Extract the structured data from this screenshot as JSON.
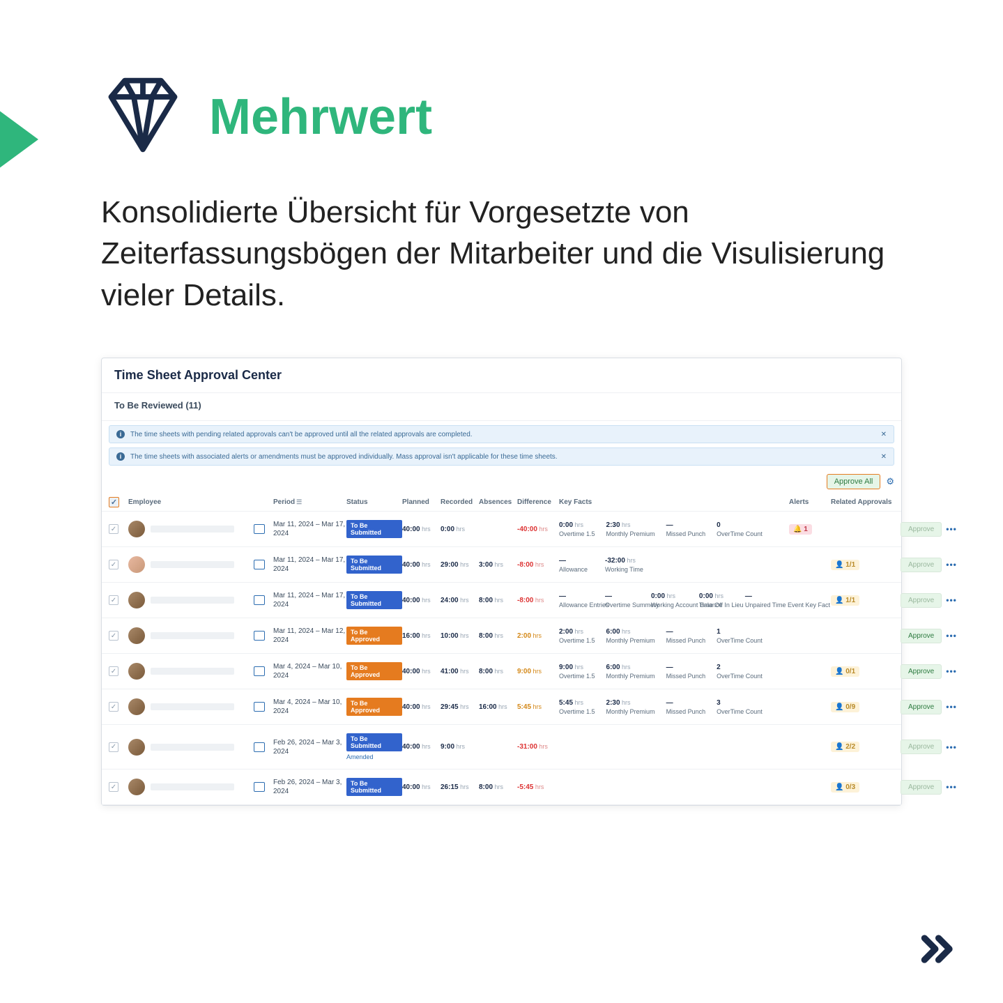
{
  "header": {
    "title": "Mehrwert",
    "subtitle": "Konsolidierte Übersicht für Vorgesetzte von Zeiterfassungsbögen der Mitarbeiter und die Visulisierung vieler Details."
  },
  "app": {
    "title": "Time Sheet Approval Center",
    "section": "To Be Reviewed (11)",
    "info1": "The time sheets with pending related approvals can't be approved until all the related approvals are completed.",
    "info2": "The time sheets with associated alerts or amendments must be approved individually. Mass approval isn't applicable for these time sheets.",
    "close_label": "✕",
    "approve_all": "Approve All",
    "approve_btn": "Approve",
    "hrs_suffix": " hrs",
    "dots": "•••",
    "columns": {
      "employee": "Employee",
      "period": "Period",
      "status": "Status",
      "planned": "Planned",
      "recorded": "Recorded",
      "absences": "Absences",
      "difference": "Difference",
      "keyfacts": "Key Facts",
      "alerts": "Alerts",
      "related": "Related Approvals"
    },
    "status_labels": {
      "to_be_submitted": "To Be Submitted",
      "to_be_approved": "To Be Approved",
      "amended": "Amended"
    },
    "rows": [
      {
        "period": "Mar 11, 2024 – Mar 17, 2024",
        "status": "to_be_submitted",
        "planned": "40:00",
        "recorded": "0:00",
        "absences": "",
        "difference": "-40:00",
        "diff_class": "neg",
        "keyfacts": [
          {
            "top": "0:00",
            "top_unit": " hrs",
            "bot": "Overtime 1.5"
          },
          {
            "top": "2:30",
            "top_unit": " hrs",
            "bot": "Monthly Premium"
          },
          {
            "top": "—",
            "bot": "Missed Punch"
          },
          {
            "top": "0",
            "bot": "OverTime Count"
          }
        ],
        "alert": "1",
        "ra": "",
        "approve_active": false,
        "avatar": "c"
      },
      {
        "period": "Mar 11, 2024 – Mar 17, 2024",
        "status": "to_be_submitted",
        "planned": "40:00",
        "recorded": "29:00",
        "absences": "3:00",
        "difference": "-8:00",
        "diff_class": "neg",
        "keyfacts": [
          {
            "top": "—",
            "bot": "Allowance"
          },
          {
            "top": "-32:00",
            "top_unit": " hrs",
            "bot": "Working Time"
          }
        ],
        "alert": "",
        "ra": "1/1",
        "approve_active": false,
        "avatar": "b"
      },
      {
        "period": "Mar 11, 2024 – Mar 17, 2024",
        "status": "to_be_submitted",
        "planned": "40:00",
        "recorded": "24:00",
        "absences": "8:00",
        "difference": "-8:00",
        "diff_class": "neg",
        "keyfacts": [
          {
            "top": "—",
            "bot": "Allowance Entries"
          },
          {
            "top": "—",
            "bot": "Overtime Summery"
          },
          {
            "top": "0:00",
            "top_unit": " hrs",
            "bot": "Working Account Balance"
          },
          {
            "top": "0:00",
            "top_unit": " hrs",
            "bot": "Time Off In Lieu"
          },
          {
            "top": "—",
            "bot": "Unpaired Time Event Key Fact"
          }
        ],
        "alert": "",
        "ra": "1/1",
        "approve_active": false,
        "avatar": "c"
      },
      {
        "period": "Mar 11, 2024 – Mar 12, 2024",
        "status": "to_be_approved",
        "planned": "16:00",
        "recorded": "10:00",
        "absences": "8:00",
        "difference": "2:00",
        "diff_class": "pos",
        "keyfacts": [
          {
            "top": "2:00",
            "top_unit": " hrs",
            "bot": "Overtime 1.5"
          },
          {
            "top": "6:00",
            "top_unit": " hrs",
            "bot": "Monthly Premium"
          },
          {
            "top": "—",
            "bot": "Missed Punch"
          },
          {
            "top": "1",
            "bot": "OverTime Count"
          }
        ],
        "alert": "",
        "ra": "",
        "approve_active": true,
        "avatar": "c"
      },
      {
        "period": "Mar 4, 2024 – Mar 10, 2024",
        "status": "to_be_approved",
        "planned": "40:00",
        "recorded": "41:00",
        "absences": "8:00",
        "difference": "9:00",
        "diff_class": "pos",
        "keyfacts": [
          {
            "top": "9:00",
            "top_unit": " hrs",
            "bot": "Overtime 1.5"
          },
          {
            "top": "6:00",
            "top_unit": " hrs",
            "bot": "Monthly Premium"
          },
          {
            "top": "—",
            "bot": "Missed Punch"
          },
          {
            "top": "2",
            "bot": "OverTime Count"
          }
        ],
        "alert": "",
        "ra": "0/1",
        "approve_active": true,
        "avatar": "c"
      },
      {
        "period": "Mar 4, 2024 – Mar 10, 2024",
        "status": "to_be_approved",
        "planned": "40:00",
        "recorded": "29:45",
        "absences": "16:00",
        "difference": "5:45",
        "diff_class": "pos",
        "keyfacts": [
          {
            "top": "5:45",
            "top_unit": " hrs",
            "bot": "Overtime 1.5"
          },
          {
            "top": "2:30",
            "top_unit": " hrs",
            "bot": "Monthly Premium"
          },
          {
            "top": "—",
            "bot": "Missed Punch"
          },
          {
            "top": "3",
            "bot": "OverTime Count"
          }
        ],
        "alert": "",
        "ra": "0/9",
        "approve_active": true,
        "avatar": "c"
      },
      {
        "period": "Feb 26, 2024 – Mar 3, 2024",
        "status": "to_be_submitted",
        "amended": true,
        "planned": "40:00",
        "recorded": "9:00",
        "absences": "",
        "difference": "-31:00",
        "diff_class": "neg",
        "keyfacts": [],
        "alert": "",
        "ra": "2/2",
        "approve_active": false,
        "avatar": "c"
      },
      {
        "period": "Feb 26, 2024 – Mar 3, 2024",
        "status": "to_be_submitted",
        "planned": "40:00",
        "recorded": "26:15",
        "absences": "8:00",
        "difference": "-5:45",
        "diff_class": "neg",
        "keyfacts": [],
        "alert": "",
        "ra": "0/3",
        "approve_active": false,
        "avatar": "c"
      }
    ]
  }
}
